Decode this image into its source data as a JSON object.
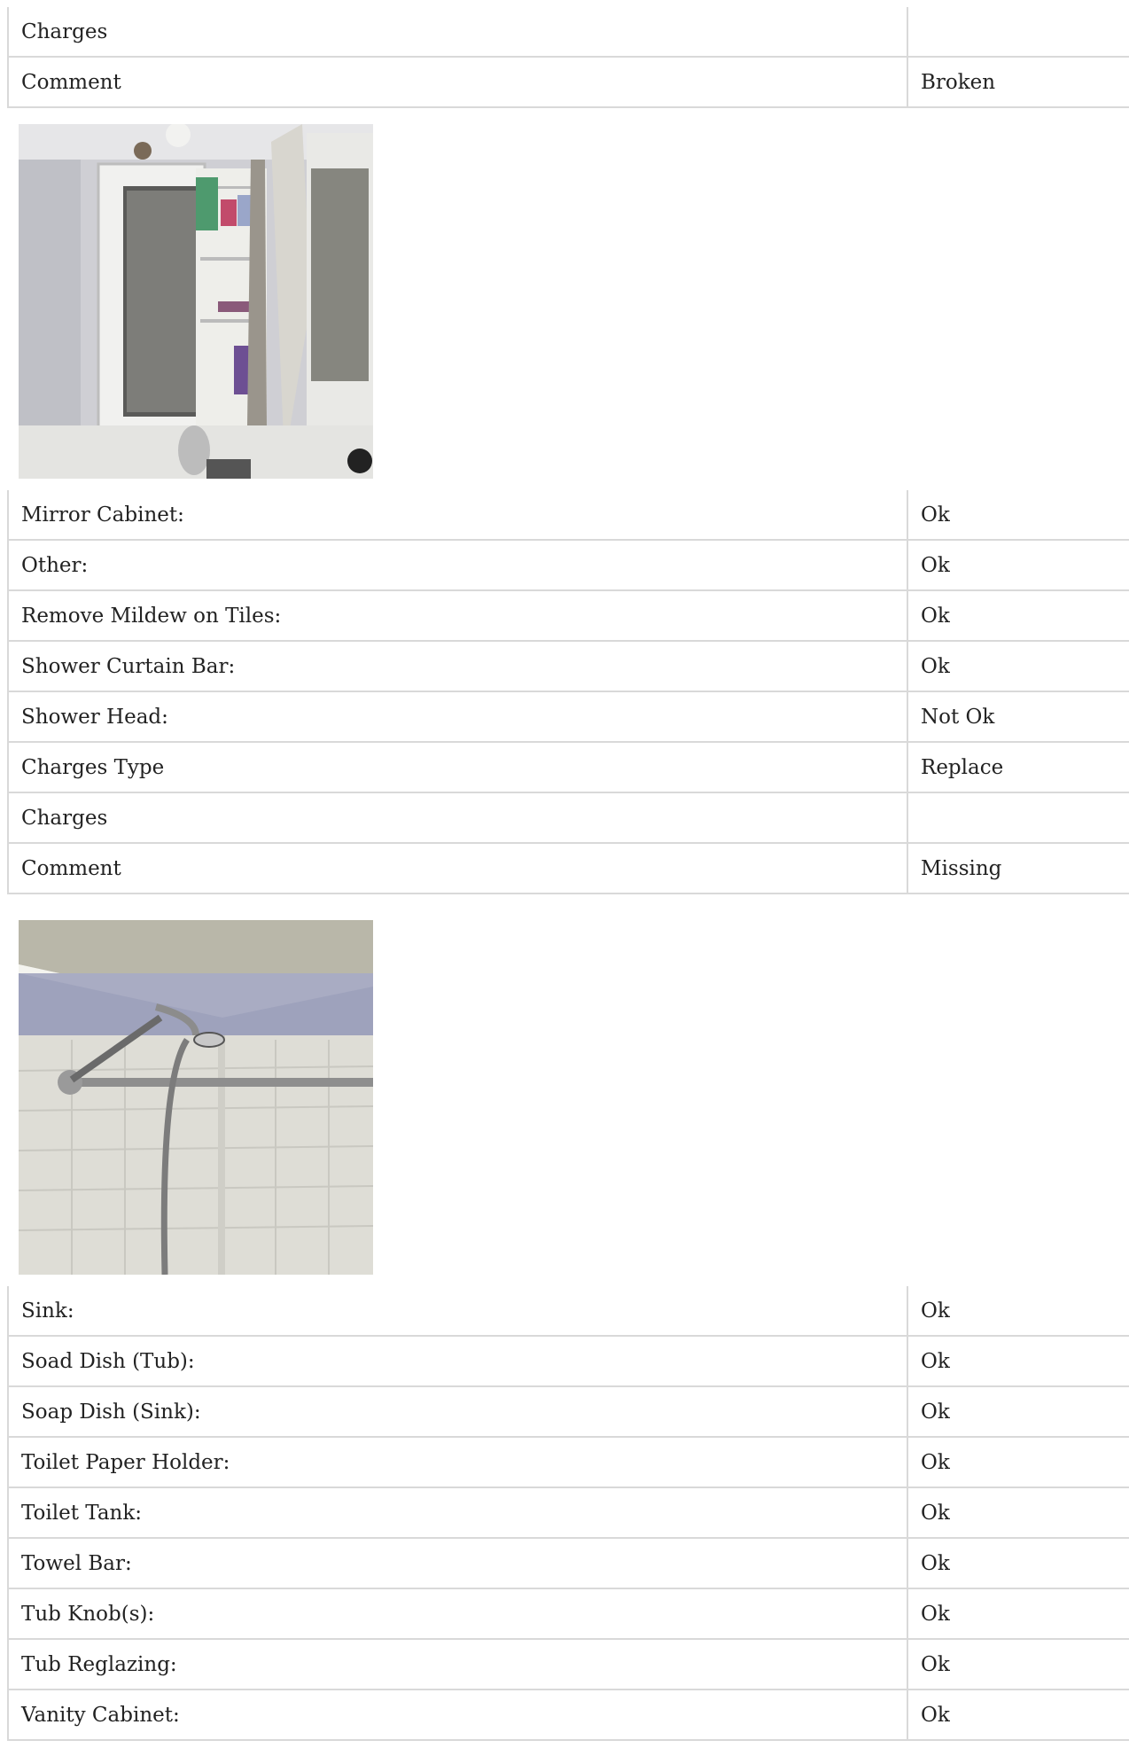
{
  "section_a": {
    "rows": [
      {
        "label": "Charges",
        "value": ""
      },
      {
        "label": "Comment",
        "value": "Broken"
      }
    ]
  },
  "photo_a": {
    "subject": "broken mirror cabinet"
  },
  "section_b": {
    "rows": [
      {
        "label": "Mirror Cabinet:",
        "value": "Ok"
      },
      {
        "label": "Other:",
        "value": "Ok"
      },
      {
        "label": "Remove Mildew on Tiles:",
        "value": "Ok"
      },
      {
        "label": "Shower Curtain Bar:",
        "value": "Ok"
      },
      {
        "label": "Shower Head:",
        "value": "Not Ok"
      },
      {
        "label": "Charges Type",
        "value": "Replace"
      },
      {
        "label": "Charges",
        "value": ""
      },
      {
        "label": "Comment",
        "value": "Missing"
      }
    ]
  },
  "photo_b": {
    "subject": "shower head and curtain bar"
  },
  "section_c": {
    "rows": [
      {
        "label": "Sink:",
        "value": "Ok"
      },
      {
        "label": "Soad Dish (Tub):",
        "value": "Ok"
      },
      {
        "label": "Soap Dish (Sink):",
        "value": "Ok"
      },
      {
        "label": "Toilet Paper Holder:",
        "value": "Ok"
      },
      {
        "label": "Toilet Tank:",
        "value": "Ok"
      },
      {
        "label": "Towel Bar:",
        "value": "Ok"
      },
      {
        "label": "Tub Knob(s):",
        "value": "Ok"
      },
      {
        "label": "Tub Reglazing:",
        "value": "Ok"
      },
      {
        "label": "Vanity Cabinet:",
        "value": "Ok"
      }
    ]
  }
}
